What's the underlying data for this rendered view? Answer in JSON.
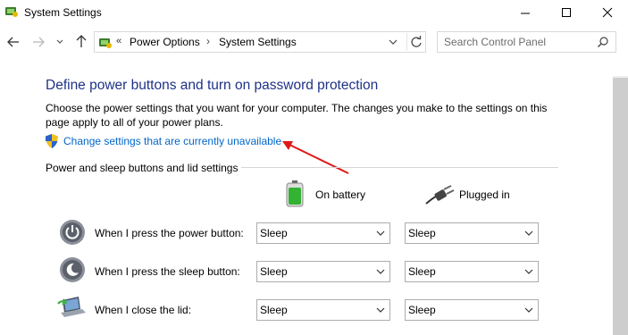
{
  "window": {
    "title": "System Settings"
  },
  "address": {
    "overflow": "«",
    "crumbs": [
      "Power Options",
      "System Settings"
    ],
    "search_placeholder": "Search Control Panel"
  },
  "main": {
    "heading": "Define power buttons and turn on password protection",
    "description": "Choose the power settings that you want for your computer. The changes you make to the settings on this page apply to all of your power plans.",
    "change_link": "Change settings that are currently unavailable",
    "section_label": "Power and sleep buttons and lid settings",
    "columns": [
      "On battery",
      "Plugged in"
    ],
    "rows": [
      {
        "label": "When I press the power button:",
        "battery": "Sleep",
        "plugged": "Sleep",
        "icon": "power-button-icon"
      },
      {
        "label": "When I press the sleep button:",
        "battery": "Sleep",
        "plugged": "Sleep",
        "icon": "sleep-button-icon"
      },
      {
        "label": "When I close the lid:",
        "battery": "Sleep",
        "plugged": "Sleep",
        "icon": "laptop-lid-icon"
      }
    ]
  },
  "colors": {
    "heading": "#1e3287",
    "link": "#0066cc",
    "annotation_arrow": "#e01818"
  }
}
